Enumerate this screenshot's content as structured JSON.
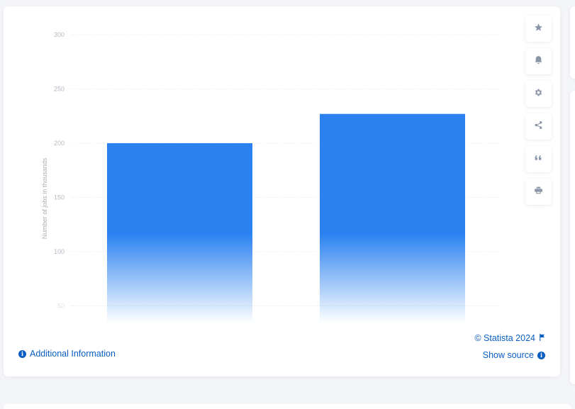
{
  "chart_data": {
    "type": "bar",
    "title": "",
    "xlabel": "",
    "ylabel": "Number of jobs in thousands",
    "categories": [
      "",
      ""
    ],
    "values": [
      200,
      227
    ],
    "ylim": [
      0,
      300
    ],
    "yticks": [
      50,
      100,
      150,
      200,
      250,
      300
    ],
    "grid": true,
    "bar_color": "#2b81f0",
    "legend": "none"
  },
  "toolbar": {
    "buttons": [
      {
        "name": "favorite",
        "icon": "star-icon"
      },
      {
        "name": "notification",
        "icon": "bell-icon"
      },
      {
        "name": "settings",
        "icon": "gear-icon"
      },
      {
        "name": "share",
        "icon": "share-icon"
      },
      {
        "name": "cite",
        "icon": "quote-icon"
      },
      {
        "name": "print",
        "icon": "print-icon"
      }
    ]
  },
  "footer": {
    "additional_info": "Additional Information",
    "copyright": "© Statista 2024",
    "show_source": "Show source"
  },
  "colors": {
    "link": "#0a5dc2",
    "bar": "#2b81f0",
    "icon": "#8b97a8"
  }
}
